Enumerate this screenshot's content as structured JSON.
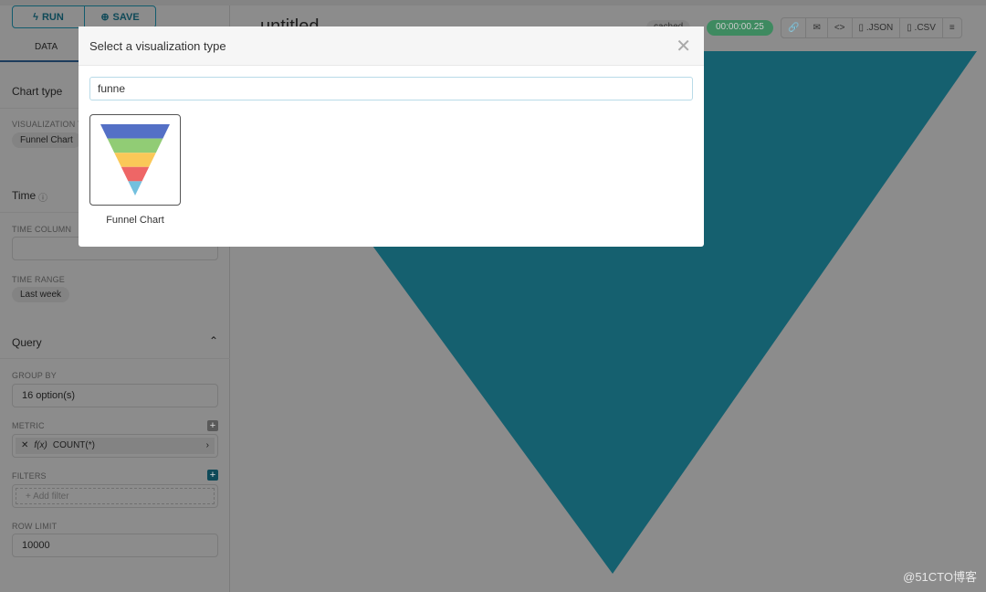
{
  "toolbar": {
    "run_label": "RUN",
    "save_label": "SAVE"
  },
  "tabs": [
    {
      "label": "DATA"
    }
  ],
  "sidebar": {
    "chart_type_title": "Chart type",
    "visualization_label": "VISUALIZATION TYPE",
    "visualization_value": "Funnel Chart",
    "time_title": "Time",
    "time_column_label": "TIME COLUMN",
    "time_range_label": "TIME RANGE",
    "time_range_value": "Last week",
    "query_title": "Query",
    "group_by_label": "GROUP BY",
    "group_by_value": "16 option(s)",
    "metric_label": "METRIC",
    "metric_value": "COUNT(*)",
    "filters_label": "FILTERS",
    "add_filter": "Add filter",
    "row_limit_label": "ROW LIMIT",
    "row_limit_value": "10000"
  },
  "header": {
    "title": "untitled",
    "badge_cached": "cached",
    "timer": "00:00:00.25",
    "json_label": ".JSON",
    "csv_label": ".CSV"
  },
  "chart": {
    "color": "#1a6a80"
  },
  "modal": {
    "title": "Select a visualization type",
    "search_value": "funne",
    "results": [
      {
        "label": "Funnel Chart"
      }
    ],
    "funnel_colors": [
      "#5470c6",
      "#91cc75",
      "#fac858",
      "#ee6666",
      "#73c0de"
    ]
  },
  "watermark": "@51CTO博客"
}
